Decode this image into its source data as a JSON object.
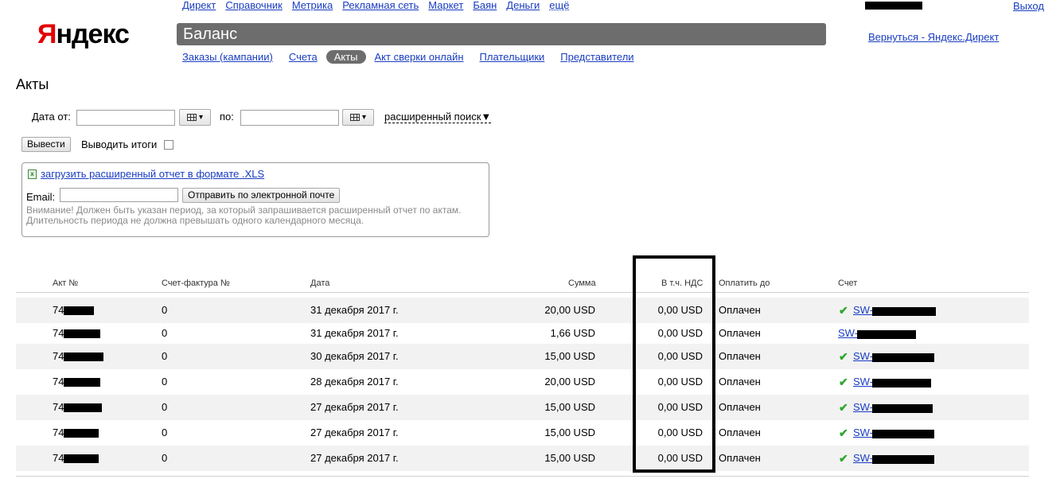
{
  "top_nav": [
    "Директ",
    "Справочник",
    "Метрика",
    "Рекламная сеть",
    "Маркет",
    "Баян",
    "Деньги",
    "ещё"
  ],
  "logout": "Выход",
  "logo": {
    "first": "Я",
    "rest": "ндекс"
  },
  "page_header": "Баланс",
  "back_link": "Вернуться - Яндекс.Директ",
  "sub_nav": {
    "items": [
      "Заказы (кампании)",
      "Счета",
      "Акты",
      "Акт сверки онлайн",
      "Плательщики",
      "Представители"
    ],
    "active_index": 2
  },
  "page_title": "Акты",
  "filter": {
    "date_from_label": "Дата от:",
    "date_from_value": "",
    "date_to_label": "по:",
    "date_to_value": "",
    "extended_search": "расширенный поиск▼",
    "submit_label": "Вывести",
    "totals_label": "Выводить итоги",
    "totals_checked": false
  },
  "report": {
    "xls_link": "загрузить расширенный отчет в формате .XLS",
    "email_label": "Email:",
    "email_value": "",
    "send_button": "Отправить по электронной почте",
    "notice_line1": "Внимание! Должен быть указан период, за который запрашивается расширенный отчет по актам.",
    "notice_line2": "Длительность периода не должна превышать одного календарного месяца."
  },
  "table": {
    "headers": [
      "Акт №",
      "Счет-фактура №",
      "Дата",
      "Сумма",
      "В т.ч. НДС",
      "Оплатить до",
      "Счет"
    ],
    "rows": [
      {
        "act": "74",
        "invoice": "0",
        "date": "31 декабря 2017 г.",
        "sum": "20,00 USD",
        "vat": "0,00 USD",
        "pay_by": "Оплачен",
        "bill": "SW-",
        "checked": true
      },
      {
        "act": "74",
        "invoice": "0",
        "date": "31 декабря 2017 г.",
        "sum": "1,66 USD",
        "vat": "0,00 USD",
        "pay_by": "Оплачен",
        "bill": "SW-",
        "checked": false
      },
      {
        "act": "74",
        "invoice": "0",
        "date": "30 декабря 2017 г.",
        "sum": "15,00 USD",
        "vat": "0,00 USD",
        "pay_by": "Оплачен",
        "bill": "SW-",
        "checked": true
      },
      {
        "act": "74",
        "invoice": "0",
        "date": "28 декабря 2017 г.",
        "sum": "20,00 USD",
        "vat": "0,00 USD",
        "pay_by": "Оплачен",
        "bill": "SW-",
        "checked": true
      },
      {
        "act": "74",
        "invoice": "0",
        "date": "27 декабря 2017 г.",
        "sum": "15,00 USD",
        "vat": "0,00 USD",
        "pay_by": "Оплачен",
        "bill": "SW-",
        "checked": true
      },
      {
        "act": "74",
        "invoice": "0",
        "date": "27 декабря 2017 г.",
        "sum": "15,00 USD",
        "vat": "0,00 USD",
        "pay_by": "Оплачен",
        "bill": "SW-",
        "checked": true
      },
      {
        "act": "74",
        "invoice": "0",
        "date": "27 декабря 2017 г.",
        "sum": "15,00 USD",
        "vat": "0,00 USD",
        "pay_by": "Оплачен",
        "bill": "SW-",
        "checked": true
      }
    ]
  },
  "colors": {
    "link": "#1a3dc1",
    "header_bar": "#6d6d6d",
    "logo_red": "#e30000",
    "check_green": "#2da62d"
  },
  "icons": [
    "calendar-icon",
    "xls-icon",
    "check-icon"
  ]
}
